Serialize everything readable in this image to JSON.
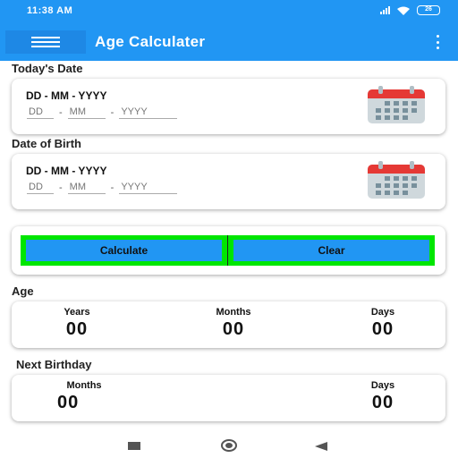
{
  "status_bar": {
    "time": "11:38 AM",
    "battery": "26"
  },
  "app_bar": {
    "title": "Age Calculater"
  },
  "todays_date": {
    "heading": "Today's Date",
    "format": "DD - MM - YYYY",
    "placeholders": {
      "dd": "DD",
      "mm": "MM",
      "yyyy": "YYYY"
    },
    "separator": "-"
  },
  "date_of_birth": {
    "heading": "Date of Birth",
    "format": "DD - MM - YYYY",
    "placeholders": {
      "dd": "DD",
      "mm": "MM",
      "yyyy": "YYYY"
    },
    "separator": "-"
  },
  "actions": {
    "calculate_label": "Calculate",
    "clear_label": "Clear"
  },
  "age": {
    "heading": "Age",
    "years_label": "Years",
    "years_value": "00",
    "months_label": "Months",
    "months_value": "00",
    "days_label": "Days",
    "days_value": "00"
  },
  "next_birthday": {
    "heading": "Next Birthday",
    "months_label": "Months",
    "months_value": "00",
    "days_label": "Days",
    "days_value": "00"
  },
  "colors": {
    "primary": "#2196f3",
    "button_panel": "#00e600",
    "calendar_header": "#e53935",
    "calendar_body": "#cfd8dc"
  }
}
